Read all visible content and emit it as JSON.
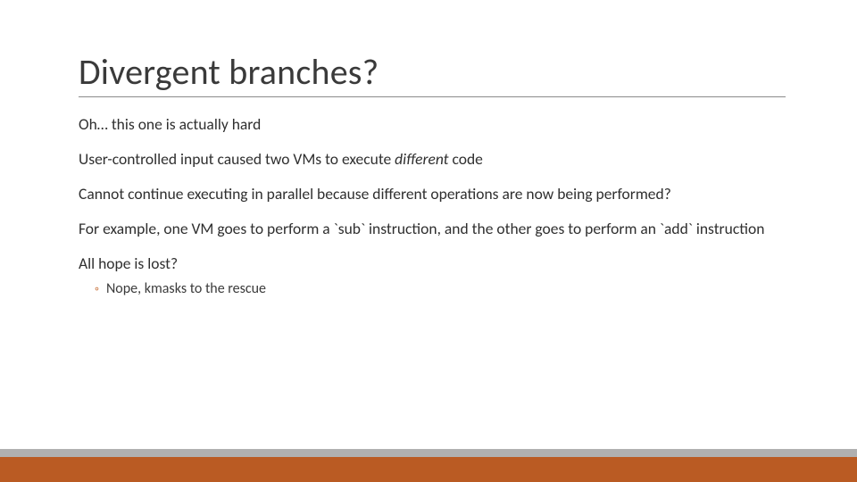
{
  "slide": {
    "title": "Divergent branches?",
    "paragraphs": {
      "p1": "Oh… this one is actually hard",
      "p2_pre": "User-controlled input caused two VMs to execute ",
      "p2_em": "different",
      "p2_post": " code",
      "p3": "Cannot continue executing in parallel because different operations are now being performed?",
      "p4": "For example, one VM goes to perform a `sub` instruction, and the other goes to perform an `add` instruction",
      "p5": "All hope is lost?",
      "sub1": "Nope, kmasks to the rescue"
    }
  }
}
